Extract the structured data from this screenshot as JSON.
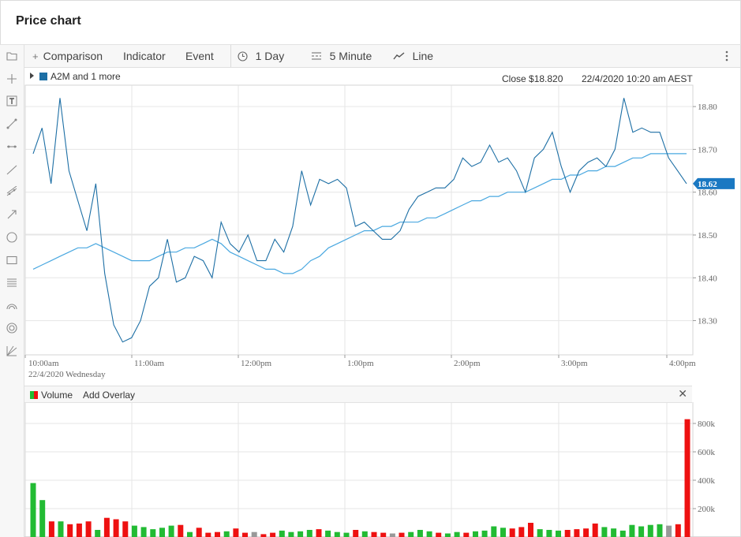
{
  "page": {
    "title": "Price chart"
  },
  "toolbar": {
    "comparison": "Comparison",
    "indicator": "Indicator",
    "event": "Event",
    "period": "1 Day",
    "interval": "5 Minute",
    "chart_type": "Line"
  },
  "legend": {
    "series": "A2M and 1 more",
    "close": "Close $18.820",
    "datetime": "22/4/2020 10:20 am AEST"
  },
  "volume_panel": {
    "label": "Volume",
    "add_overlay": "Add Overlay"
  },
  "colors": {
    "price_line": "#1d6fa5",
    "average_line": "#4aa8e0",
    "last_price_tag": "#1a78c2",
    "volume_up": "#22bb33",
    "volume_down": "#ee1111",
    "volume_neutral": "#999999"
  },
  "icons": [
    "folder-icon",
    "crosshair-icon",
    "text-tool-icon",
    "line-tool-icon",
    "horizontal-line-icon",
    "ray-icon",
    "channel-icon",
    "arrow-icon",
    "ellipse-icon",
    "rectangle-icon",
    "fibonacci-icon",
    "arc-icon",
    "circles-icon",
    "gann-icon",
    "plus-icon",
    "clock-icon",
    "interval-icon",
    "line-chart-icon",
    "more-vertical-icon",
    "close-icon"
  ],
  "chart_data": [
    {
      "type": "line",
      "x_tick_labels": [
        "10:00am",
        "11:00am",
        "12:00pm",
        "1:00pm",
        "2:00pm",
        "3:00pm",
        "4:00pm"
      ],
      "x_sub_label": "22/4/2020 Wednesday",
      "ylim": [
        18.22,
        18.85
      ],
      "y_tick_labels": [
        "18.80",
        "18.70",
        "18.60",
        "18.50",
        "18.40",
        "18.30"
      ],
      "y_ticks": [
        18.8,
        18.7,
        18.6,
        18.5,
        18.4,
        18.3
      ],
      "last_price_label": "18.62",
      "last_price": 18.62,
      "grid": true,
      "interval_minutes": 5,
      "series": [
        {
          "values": [
            18.69,
            18.75,
            18.62,
            18.82,
            18.65,
            18.58,
            18.51,
            18.62,
            18.41,
            18.29,
            18.25,
            18.26,
            18.3,
            18.38,
            18.4,
            18.49,
            18.39,
            18.4,
            18.45,
            18.44,
            18.4,
            18.53,
            18.48,
            18.46,
            18.5,
            18.44,
            18.44,
            18.49,
            18.46,
            18.52,
            18.65,
            18.57,
            18.63,
            18.62,
            18.63,
            18.61,
            18.52,
            18.53,
            18.51,
            18.49,
            18.49,
            18.51,
            18.56,
            18.59,
            18.6,
            18.61,
            18.61,
            18.63,
            18.68,
            18.66,
            18.67,
            18.71,
            18.67,
            18.68,
            18.65,
            18.6,
            18.68,
            18.7,
            18.74,
            18.66,
            18.6,
            18.65,
            18.67,
            18.68,
            18.66,
            18.7,
            18.82,
            18.74,
            18.75,
            18.74,
            18.74,
            18.68,
            18.65,
            18.62
          ]
        },
        {
          "values": [
            18.42,
            18.43,
            18.44,
            18.45,
            18.46,
            18.47,
            18.47,
            18.48,
            18.47,
            18.46,
            18.45,
            18.44,
            18.44,
            18.44,
            18.45,
            18.46,
            18.46,
            18.47,
            18.47,
            18.48,
            18.49,
            18.48,
            18.46,
            18.45,
            18.44,
            18.43,
            18.42,
            18.42,
            18.41,
            18.41,
            18.42,
            18.44,
            18.45,
            18.47,
            18.48,
            18.49,
            18.5,
            18.51,
            18.51,
            18.52,
            18.52,
            18.53,
            18.53,
            18.53,
            18.54,
            18.54,
            18.55,
            18.56,
            18.57,
            18.58,
            18.58,
            18.59,
            18.59,
            18.6,
            18.6,
            18.6,
            18.61,
            18.62,
            18.63,
            18.63,
            18.64,
            18.64,
            18.65,
            18.65,
            18.66,
            18.66,
            18.67,
            18.68,
            18.68,
            18.69,
            18.69,
            18.69,
            18.69,
            18.69
          ]
        }
      ]
    },
    {
      "type": "bar",
      "ylim": [
        0,
        950000
      ],
      "y_tick_labels": [
        "800k",
        "600k",
        "400k",
        "200k"
      ],
      "y_ticks": [
        800000,
        600000,
        400000,
        200000
      ],
      "values": [
        380000,
        260000,
        110000,
        110000,
        90000,
        95000,
        110000,
        50000,
        135000,
        125000,
        110000,
        80000,
        70000,
        55000,
        65000,
        80000,
        85000,
        35000,
        65000,
        30000,
        35000,
        40000,
        60000,
        30000,
        35000,
        20000,
        30000,
        45000,
        35000,
        40000,
        50000,
        55000,
        45000,
        35000,
        30000,
        50000,
        40000,
        35000,
        30000,
        25000,
        30000,
        35000,
        50000,
        40000,
        30000,
        25000,
        35000,
        30000,
        40000,
        45000,
        75000,
        65000,
        60000,
        70000,
        100000,
        55000,
        50000,
        45000,
        50000,
        55000,
        60000,
        95000,
        70000,
        60000,
        45000,
        85000,
        75000,
        85000,
        90000,
        80000,
        90000,
        830000
      ],
      "directions": [
        "up",
        "up",
        "down",
        "up",
        "down",
        "down",
        "down",
        "up",
        "down",
        "down",
        "down",
        "up",
        "up",
        "up",
        "up",
        "up",
        "down",
        "up",
        "down",
        "down",
        "down",
        "up",
        "down",
        "down",
        "neutral",
        "down",
        "down",
        "up",
        "up",
        "up",
        "up",
        "down",
        "up",
        "up",
        "up",
        "down",
        "up",
        "down",
        "down",
        "neutral",
        "down",
        "up",
        "up",
        "up",
        "down",
        "up",
        "up",
        "down",
        "up",
        "up",
        "up",
        "up",
        "down",
        "down",
        "down",
        "up",
        "up",
        "up",
        "down",
        "down",
        "down",
        "down",
        "up",
        "up",
        "up",
        "up",
        "up",
        "up",
        "up",
        "neutral",
        "down",
        "down"
      ]
    }
  ]
}
